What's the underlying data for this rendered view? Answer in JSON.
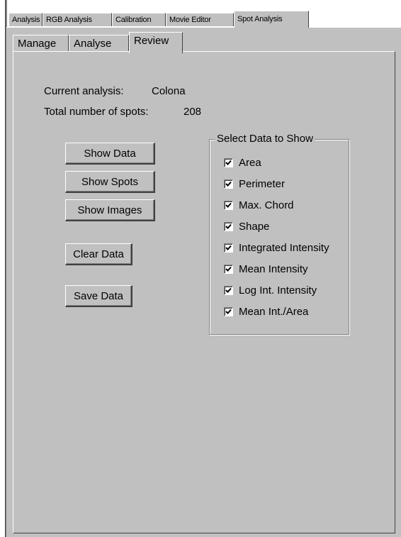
{
  "outer_tabs": [
    {
      "label": "Analysis",
      "active": false
    },
    {
      "label": "RGB Analysis",
      "active": false
    },
    {
      "label": "Calibration",
      "active": false
    },
    {
      "label": "Movie Editor",
      "active": false
    },
    {
      "label": "Spot Analysis",
      "active": true
    }
  ],
  "inner_tabs": [
    {
      "label": "Manage",
      "active": false
    },
    {
      "label": "Analyse",
      "active": false
    },
    {
      "label": "Review",
      "active": true
    }
  ],
  "info": {
    "current_analysis_label": "Current analysis:",
    "current_analysis_value": "Colona",
    "total_spots_label": "Total number of spots:",
    "total_spots_value": "208"
  },
  "buttons": {
    "show_data": "Show Data",
    "show_spots": "Show Spots",
    "show_images": "Show Images",
    "clear_data": "Clear Data",
    "save_data": "Save Data"
  },
  "data_group": {
    "title": "Select Data to Show",
    "items": [
      {
        "label": "Area",
        "checked": true
      },
      {
        "label": "Perimeter",
        "checked": true
      },
      {
        "label": "Max. Chord",
        "checked": true
      },
      {
        "label": "Shape",
        "checked": true
      },
      {
        "label": "Integrated Intensity",
        "checked": true
      },
      {
        "label": "Mean Intensity",
        "checked": true
      },
      {
        "label": "Log Int. Intensity",
        "checked": true
      },
      {
        "label": "Mean Int./Area",
        "checked": true
      }
    ]
  }
}
